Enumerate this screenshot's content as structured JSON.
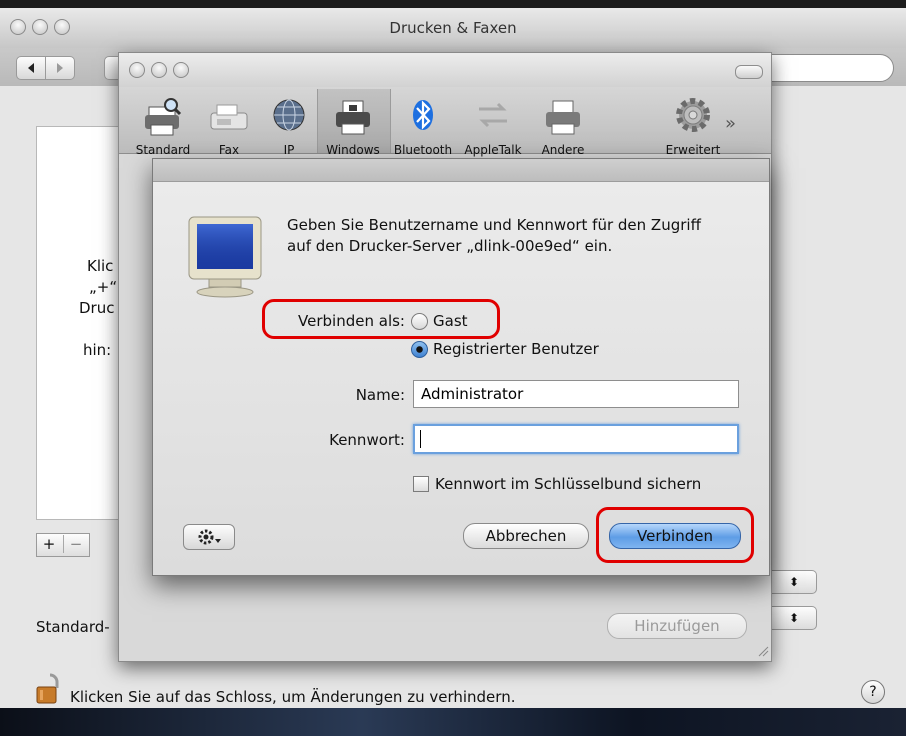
{
  "back_window": {
    "title": "Drucken & Faxen",
    "list_fragments": [
      "Klic",
      "„+“",
      "Druc",
      "hin:"
    ],
    "add_symbol": "+",
    "remove_symbol": "−",
    "default_label": "Standard-",
    "popup_arrows": "⬍",
    "lock_text": "Klicken Sie auf das Schloss, um Änderungen zu verhindern.",
    "help_symbol": "?"
  },
  "sheet": {
    "toolbar": [
      {
        "label": "Standard",
        "icon": "printer-magnifier-icon"
      },
      {
        "label": "Fax",
        "icon": "fax-icon"
      },
      {
        "label": "IP",
        "icon": "globe-icon"
      },
      {
        "label": "Windows",
        "icon": "windows-printer-icon"
      },
      {
        "label": "Bluetooth",
        "icon": "bluetooth-icon"
      },
      {
        "label": "AppleTalk",
        "icon": "appletalk-icon"
      },
      {
        "label": "Andere",
        "icon": "printer-icon"
      },
      {
        "label": "Erweitert",
        "icon": "gear-icon"
      }
    ],
    "overflow_symbol": "»",
    "add_button": "Hinzufügen"
  },
  "dialog": {
    "message": "Geben Sie Benutzername und Kennwort für den Zugriff auf den Drucker-Server „dlink-00e9ed“ ein.",
    "connect_as_label": "Verbinden als:",
    "options": [
      {
        "label": "Gast",
        "selected": false
      },
      {
        "label": "Registrierter Benutzer",
        "selected": true
      }
    ],
    "name_label": "Name:",
    "name_value": "Administrator",
    "password_label": "Kennwort:",
    "password_value": "",
    "keychain_label": "Kennwort im Schlüsselbund sichern",
    "keychain_checked": false,
    "cancel_label": "Abbrechen",
    "connect_label": "Verbinden"
  },
  "colors": {
    "annotation": "#e00000",
    "default_button": "#5e9de6"
  }
}
